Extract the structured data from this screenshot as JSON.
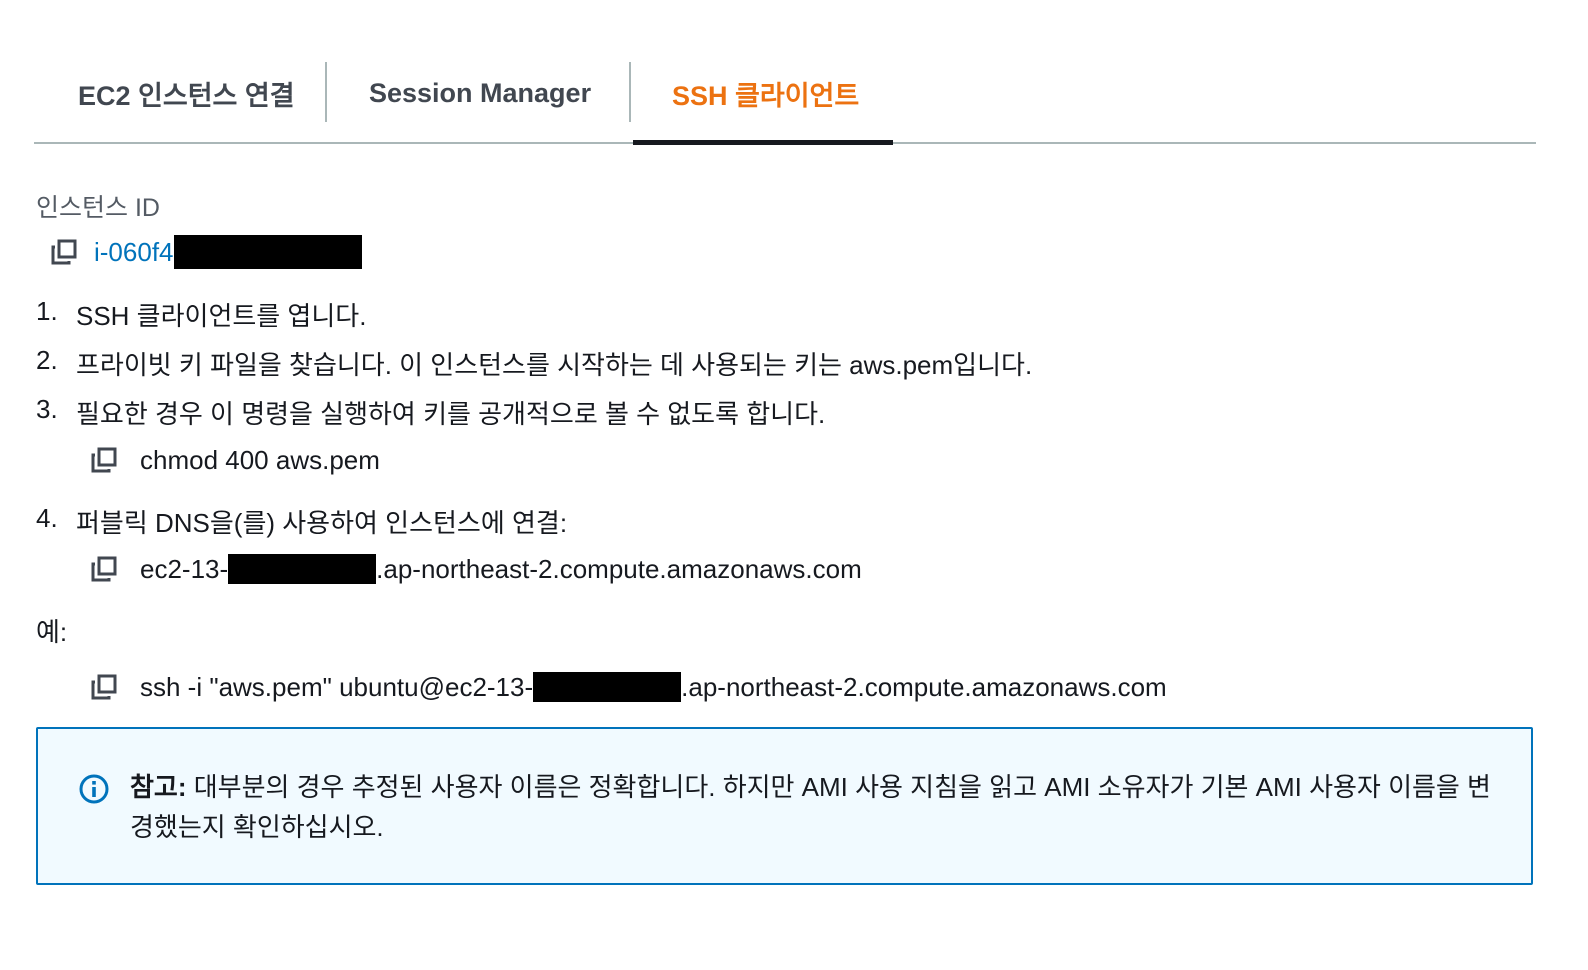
{
  "tabs": [
    {
      "label": "EC2 인스턴스 연결",
      "active": false
    },
    {
      "label": "Session Manager",
      "active": false
    },
    {
      "label": "SSH 클라이언트",
      "active": true
    }
  ],
  "instance": {
    "label": "인스턴스 ID",
    "id_visible": "i-060f4"
  },
  "steps": [
    {
      "num": "1.",
      "text": "SSH 클라이언트를 엽니다."
    },
    {
      "num": "2.",
      "text": "프라이빗 키 파일을 찾습니다. 이 인스턴스를 시작하는 데 사용되는 키는 aws.pem입니다."
    },
    {
      "num": "3.",
      "text": "필요한 경우 이 명령을 실행하여 키를 공개적으로 볼 수 없도록 합니다."
    },
    {
      "num": "4.",
      "text": "퍼블릭 DNS을(를) 사용하여 인스턴스에 연결:"
    }
  ],
  "commands": {
    "chmod": "chmod 400 aws.pem",
    "dns_prefix": "ec2-13-",
    "dns_suffix": ".ap-northeast-2.compute.amazonaws.com",
    "ssh_prefix": "ssh -i \"aws.pem\" ubuntu@ec2-13-",
    "ssh_suffix": ".ap-northeast-2.compute.amazonaws.com"
  },
  "example_label": "예:",
  "alert": {
    "title": "참고:",
    "body": " 대부분의 경우 추정된 사용자 이름은 정확합니다. 하지만 AMI 사용 지침을 읽고 AMI 소유자가 기본 AMI 사용자 이름을 변경했는지 확인하십시오."
  },
  "colors": {
    "active_tab": "#ec7211",
    "link": "#0073bb",
    "alert_border": "#0073bb",
    "alert_bg": "#f1faff"
  },
  "icons": [
    "copy-icon",
    "info-icon"
  ]
}
